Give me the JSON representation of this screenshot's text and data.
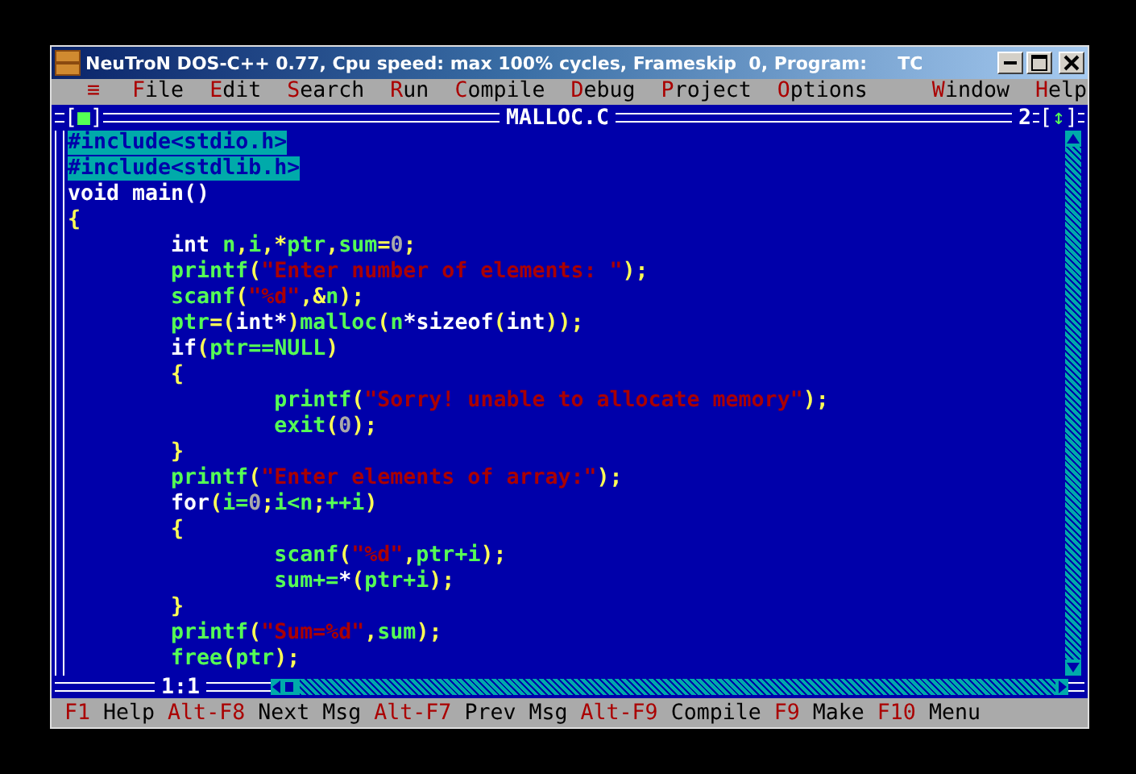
{
  "window": {
    "title": "NeuTroN DOS-C++ 0.77, Cpu speed: max 100% cycles, Frameskip  0, Program:     TC"
  },
  "menu": {
    "system": "≡",
    "items": [
      "**F**ile",
      "**E**dit",
      "**S**earch",
      "**R**un",
      "**C**ompile",
      "**D**ebug",
      "**P**roject",
      "**O**ptions",
      "**W**indow",
      "**H**elp"
    ]
  },
  "editor": {
    "close_box": "[■]",
    "filename": "MALLOC.C",
    "window_number": "2",
    "zoom_box": "[↕]",
    "position": "1:1",
    "lines": [
      {
        "selected": true,
        "tokens": [
          {
            "kind": "kw",
            "text": "#include<stdio.h>"
          }
        ]
      },
      {
        "selected": true,
        "tokens": [
          {
            "kind": "kw",
            "text": "#include<stdlib.h>"
          }
        ]
      },
      {
        "selected": false,
        "tokens": [
          {
            "kind": "kw",
            "text": "void main()"
          }
        ]
      },
      {
        "selected": false,
        "tokens": [
          {
            "kind": "op",
            "text": "{"
          }
        ],
        "children": [
          {
            "selected": false,
            "tokens": [
              {
                "kind": "kw",
                "text": "int "
              },
              {
                "kind": "id",
                "text": "n"
              },
              {
                "kind": "op",
                "text": ","
              },
              {
                "kind": "id",
                "text": "i"
              },
              {
                "kind": "op",
                "text": ",*"
              },
              {
                "kind": "id",
                "text": "ptr"
              },
              {
                "kind": "op",
                "text": ","
              },
              {
                "kind": "id",
                "text": "sum"
              },
              {
                "kind": "op",
                "text": "="
              },
              {
                "kind": "num",
                "text": "0"
              },
              {
                "kind": "op",
                "text": ";"
              }
            ]
          },
          {
            "selected": false,
            "tokens": [
              {
                "kind": "id",
                "text": "printf"
              },
              {
                "kind": "op",
                "text": "("
              },
              {
                "kind": "str",
                "text": "\"Enter number of elements: \""
              },
              {
                "kind": "op",
                "text": ");"
              }
            ]
          },
          {
            "selected": false,
            "tokens": [
              {
                "kind": "id",
                "text": "scanf"
              },
              {
                "kind": "op",
                "text": "("
              },
              {
                "kind": "str",
                "text": "\"%d\""
              },
              {
                "kind": "op",
                "text": ",&"
              },
              {
                "kind": "id",
                "text": "n"
              },
              {
                "kind": "op",
                "text": ");"
              }
            ]
          },
          {
            "selected": false,
            "tokens": [
              {
                "kind": "id",
                "text": "ptr"
              },
              {
                "kind": "op",
                "text": "=("
              },
              {
                "kind": "kw",
                "text": "int*"
              },
              {
                "kind": "op",
                "text": ")"
              },
              {
                "kind": "id",
                "text": "malloc"
              },
              {
                "kind": "op",
                "text": "("
              },
              {
                "kind": "id",
                "text": "n"
              },
              {
                "kind": "kw",
                "text": "*sizeof"
              },
              {
                "kind": "op",
                "text": "("
              },
              {
                "kind": "kw",
                "text": "int"
              },
              {
                "kind": "op",
                "text": "));"
              }
            ]
          },
          {
            "selected": false,
            "tokens": [
              {
                "kind": "kw",
                "text": "if"
              },
              {
                "kind": "op",
                "text": "("
              },
              {
                "kind": "id",
                "text": "ptr==NULL"
              },
              {
                "kind": "op",
                "text": ")"
              }
            ]
          },
          {
            "selected": false,
            "tokens": [
              {
                "kind": "op",
                "text": "{"
              }
            ],
            "children": [
              {
                "selected": false,
                "tokens": [
                  {
                    "kind": "id",
                    "text": "printf"
                  },
                  {
                    "kind": "op",
                    "text": "("
                  },
                  {
                    "kind": "str",
                    "text": "\"Sorry! unable to allocate memory\""
                  },
                  {
                    "kind": "op",
                    "text": ");"
                  }
                ]
              },
              {
                "selected": false,
                "tokens": [
                  {
                    "kind": "id",
                    "text": "exit"
                  },
                  {
                    "kind": "op",
                    "text": "("
                  },
                  {
                    "kind": "num",
                    "text": "0"
                  },
                  {
                    "kind": "op",
                    "text": ");"
                  }
                ]
              }
            ]
          },
          {
            "selected": false,
            "tokens": [
              {
                "kind": "op",
                "text": "}"
              }
            ]
          },
          {
            "selected": false,
            "tokens": [
              {
                "kind": "id",
                "text": "printf"
              },
              {
                "kind": "op",
                "text": "("
              },
              {
                "kind": "str",
                "text": "\"Enter elements of array:\""
              },
              {
                "kind": "op",
                "text": ");"
              }
            ]
          },
          {
            "selected": false,
            "tokens": [
              {
                "kind": "kw",
                "text": "for"
              },
              {
                "kind": "op",
                "text": "("
              },
              {
                "kind": "id",
                "text": "i="
              },
              {
                "kind": "num",
                "text": "0"
              },
              {
                "kind": "op",
                "text": ";"
              },
              {
                "kind": "id",
                "text": "i<n"
              },
              {
                "kind": "op",
                "text": ";"
              },
              {
                "kind": "id",
                "text": "++i"
              },
              {
                "kind": "op",
                "text": ")"
              }
            ]
          },
          {
            "selected": false,
            "tokens": [
              {
                "kind": "op",
                "text": "{"
              }
            ],
            "children": [
              {
                "selected": false,
                "tokens": [
                  {
                    "kind": "id",
                    "text": "scanf"
                  },
                  {
                    "kind": "op",
                    "text": "("
                  },
                  {
                    "kind": "str",
                    "text": "\"%d\""
                  },
                  {
                    "kind": "op",
                    "text": ","
                  },
                  {
                    "kind": "id",
                    "text": "ptr+i"
                  },
                  {
                    "kind": "op",
                    "text": ");"
                  }
                ]
              },
              {
                "selected": false,
                "tokens": [
                  {
                    "kind": "id",
                    "text": "sum+="
                  },
                  {
                    "kind": "kw",
                    "text": "*"
                  },
                  {
                    "kind": "op",
                    "text": "("
                  },
                  {
                    "kind": "id",
                    "text": "ptr+i"
                  },
                  {
                    "kind": "op",
                    "text": ");"
                  }
                ]
              }
            ]
          },
          {
            "selected": false,
            "tokens": [
              {
                "kind": "op",
                "text": "}"
              }
            ]
          },
          {
            "selected": false,
            "tokens": [
              {
                "kind": "id",
                "text": "printf"
              },
              {
                "kind": "op",
                "text": "("
              },
              {
                "kind": "str",
                "text": "\"Sum=%d\""
              },
              {
                "kind": "op",
                "text": ","
              },
              {
                "kind": "id",
                "text": "sum"
              },
              {
                "kind": "op",
                "text": ");"
              }
            ]
          },
          {
            "selected": false,
            "tokens": [
              {
                "kind": "id",
                "text": "free"
              },
              {
                "kind": "op",
                "text": "("
              },
              {
                "kind": "id",
                "text": "ptr"
              },
              {
                "kind": "op",
                "text": ");"
              }
            ]
          }
        ]
      }
    ]
  },
  "status_bar": [
    "**F1** Help",
    "**Alt-F8** Next Msg",
    "**Alt-F7** Prev Msg",
    "**Alt-F9** Compile",
    "**F9** Make",
    "**F10** Menu"
  ]
}
